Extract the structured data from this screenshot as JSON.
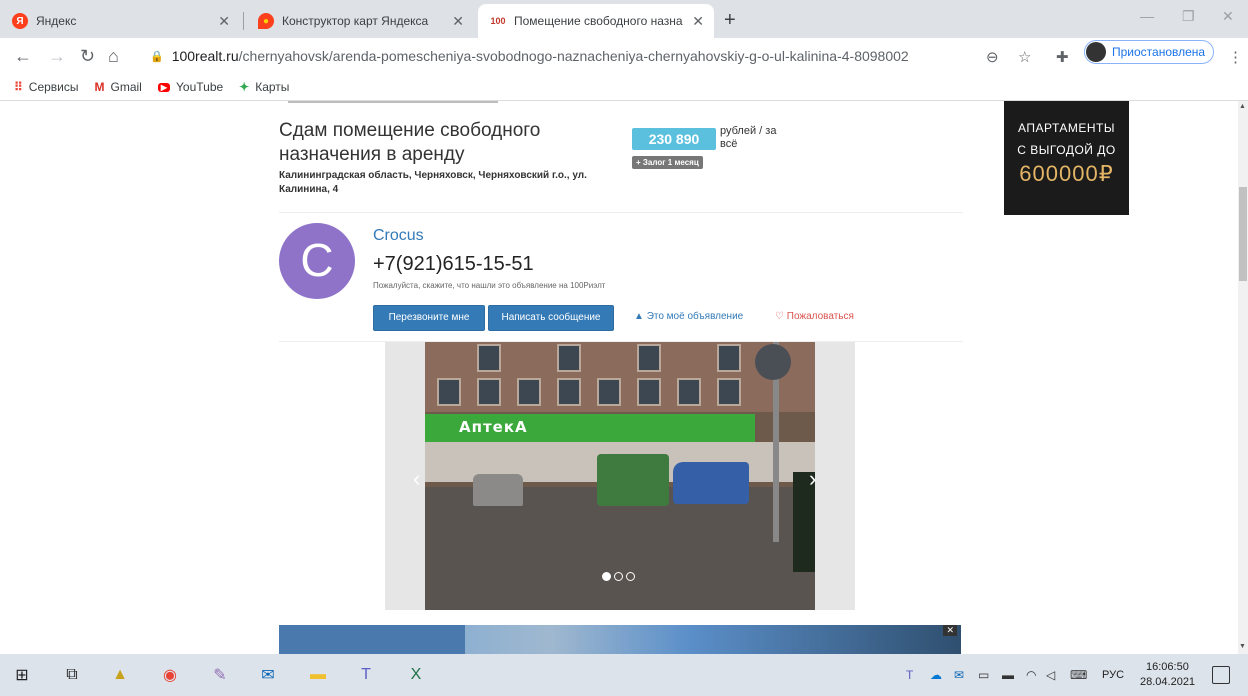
{
  "browser": {
    "tabs": [
      {
        "title": "Яндекс",
        "icon": "yandex-icon",
        "active": false
      },
      {
        "title": "Конструктор карт Яндекса",
        "icon": "yandex-maps-icon",
        "active": false
      },
      {
        "title": "Помещение свободного назна",
        "icon": "100realt-icon",
        "active": true
      }
    ],
    "url_host": "100realt.ru",
    "url_path": "/chernyahovsk/arenda-pomescheniya-svobodnogo-naznacheniya-chernyahovskiy-g-o-ul-kalinina-4-8098002",
    "profile_label": "Приостановлена",
    "bookmarks": [
      "Сервисы",
      "Gmail",
      "YouTube",
      "Карты"
    ]
  },
  "listing": {
    "title": "Сдам помещение свободного назначения в аренду",
    "address": "Калининградская область, Черняховск, Черняховский г.о., ул. Калинина, 4",
    "price": "230 890",
    "price_unit": "рублей / за всё",
    "deposit": "+ Залог 1 месяц"
  },
  "seller": {
    "initial": "C",
    "name": "Crocus",
    "phone": "+7(921)615-15-51",
    "note": "Пожалуйста, скажите, что нашли это объявление на 100Риэлт",
    "callback_label": "Перезвоните мне",
    "message_label": "Написать сообщение",
    "my_ad_label": "Это моё объявление",
    "complain_label": "Пожаловаться"
  },
  "gallery": {
    "sign_text": "АптекА",
    "current": 1,
    "total": 3
  },
  "side_ad": {
    "line1": "АПАРТАМЕНТЫ",
    "line2": "С ВЫГОДОЙ ДО",
    "line3": "600000₽"
  },
  "taskbar": {
    "lang": "РУС",
    "time": "16:06:50",
    "date": "28.04.2021"
  }
}
